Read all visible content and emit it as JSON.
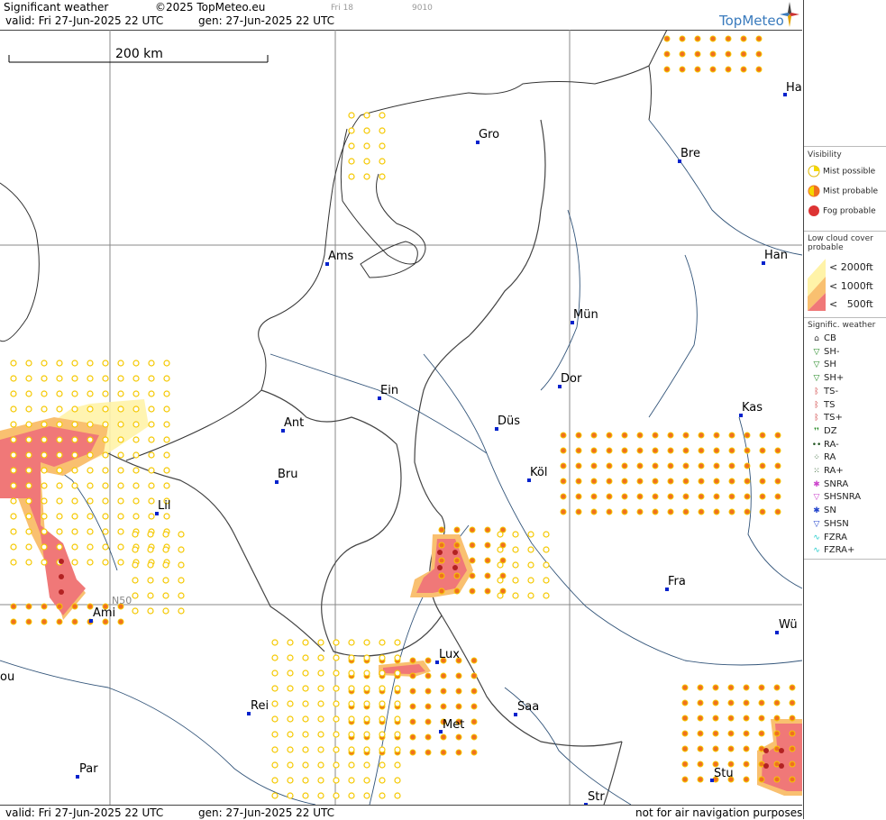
{
  "header": {
    "title": "Significant weather",
    "copyright": "©2025 TopMeteo.eu",
    "valid": "valid:  Fri  27-Jun-2025  22 UTC",
    "gen": "gen: 27-Jun-2025 22 UTC",
    "tag1": "Fri 18",
    "tag2": "9010",
    "logo": "TopMeteo"
  },
  "footer": {
    "valid": "valid:  Fri  27-Jun-2025  22 UTC",
    "gen": "gen: 27-Jun-2025 22 UTC",
    "disclaimer": "not for air navigation purposes"
  },
  "map": {
    "scale_label": "200 km",
    "graticule_label": "N50",
    "cities": [
      {
        "name": "Gro"
      },
      {
        "name": "Bre"
      },
      {
        "name": "Ha"
      },
      {
        "name": "Ams"
      },
      {
        "name": "Han"
      },
      {
        "name": "Mün"
      },
      {
        "name": "Ein"
      },
      {
        "name": "Dor"
      },
      {
        "name": "Ant"
      },
      {
        "name": "Düs"
      },
      {
        "name": "Kas"
      },
      {
        "name": "Bru"
      },
      {
        "name": "Köl"
      },
      {
        "name": "Lil"
      },
      {
        "name": "Fra"
      },
      {
        "name": "Ami"
      },
      {
        "name": "Wü"
      },
      {
        "name": "Lux"
      },
      {
        "name": "ou"
      },
      {
        "name": "Rei"
      },
      {
        "name": "Saa"
      },
      {
        "name": "Met"
      },
      {
        "name": "Par"
      },
      {
        "name": "Stu"
      },
      {
        "name": "Str"
      }
    ]
  },
  "legend": {
    "visibility_title": "Visibility",
    "visibility": [
      "Mist possible",
      "Mist probable",
      "Fog probable"
    ],
    "lowcloud_title": "Low cloud cover probable",
    "lowcloud": [
      "< 2000ft",
      "< 1000ft",
      "<   500ft"
    ],
    "sigwx_title": "Signific. weather",
    "sigwx": [
      "CB",
      "SH-",
      "SH",
      "SH+",
      "TS-",
      "TS",
      "TS+",
      "DZ",
      "RA-",
      "RA",
      "RA+",
      "SNRA",
      "SHSNRA",
      "SN",
      "SHSN",
      "FZRA",
      "FZRA+"
    ],
    "colors": {
      "mist_possible": "#f5d800",
      "mist_probable": "#f07020",
      "fog": "#dd3333",
      "cloud2000": "#fff3a8",
      "cloud1000": "#f9c070",
      "cloud500": "#f07878"
    }
  }
}
